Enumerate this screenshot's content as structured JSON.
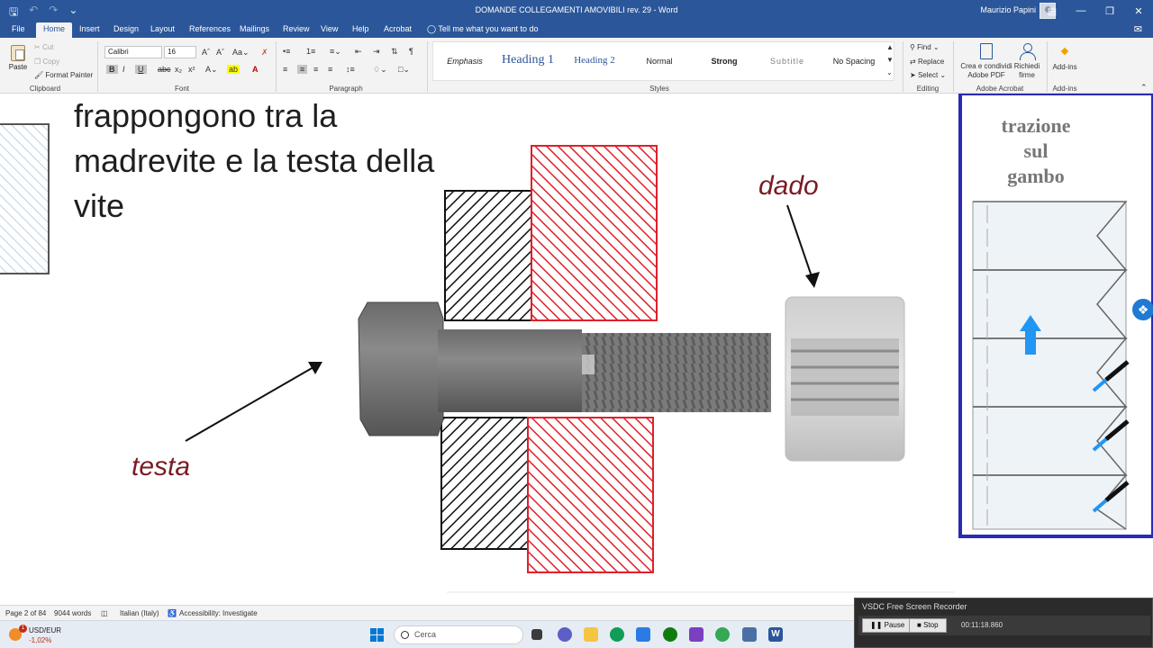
{
  "titlebar": {
    "doc_title": "DOMANDE COLLEGAMENTI AMOVIBILI rev. 29  -  Word",
    "user": "Maurizio Papini",
    "save_icon": "save-icon",
    "undo_icon": "undo-icon",
    "redo_icon": "redo-icon",
    "customize_icon": "chevron-down-icon"
  },
  "tabs": [
    "File",
    "Home",
    "Insert",
    "Design",
    "Layout",
    "References",
    "Mailings",
    "Review",
    "View",
    "Help",
    "Acrobat"
  ],
  "tell_me": "Tell me what you want to do",
  "ribbon": {
    "clipboard": {
      "label": "Clipboard",
      "paste": "Paste",
      "cut": "Cut",
      "copy": "Copy",
      "format_painter": "Format Painter"
    },
    "font": {
      "label": "Font",
      "family": "Calibri",
      "size": "16"
    },
    "paragraph": {
      "label": "Paragraph"
    },
    "styles": {
      "label": "Styles",
      "items": [
        "Emphasis",
        "Heading 1",
        "Heading 2",
        "Normal",
        "Strong",
        "Subtitle",
        "No Spacing"
      ]
    },
    "editing": {
      "label": "Editing",
      "find": "Find",
      "replace": "Replace",
      "select": "Select"
    },
    "acrobat": {
      "label": "Adobe Acrobat",
      "create_line1": "Crea e condividi",
      "create_line2": "Adobe PDF",
      "request_line1": "Richiedi",
      "request_line2": "firme"
    },
    "addins": {
      "label": "Add-ins",
      "button": "Add-ins"
    }
  },
  "document": {
    "lines": [
      "frappongono tra la",
      "madrevite e la testa della",
      "vite"
    ],
    "labels": {
      "dado": "dado",
      "testa": "testa"
    },
    "inset_caption": [
      "trazione",
      "sul",
      "gambo"
    ]
  },
  "status": {
    "page": "Page 2 of 84",
    "words": "9044 words",
    "language": "Italian (Italy)",
    "accessibility": "Accessibility: Investigate"
  },
  "taskbar": {
    "ticker_pair": "USD/EUR",
    "ticker_change": "-1,02%",
    "ticker_badge": "1",
    "search_placeholder": "Cerca"
  },
  "recorder": {
    "title": "VSDC Free Screen Recorder",
    "pause": "Pause",
    "stop": "Stop",
    "time": "00:11:18.860"
  }
}
